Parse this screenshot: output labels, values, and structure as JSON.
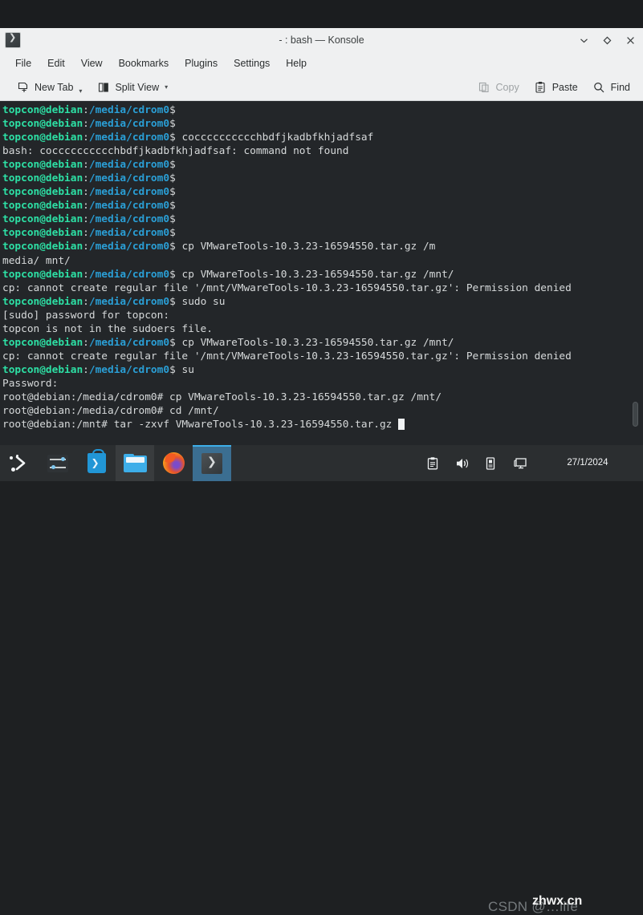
{
  "window": {
    "title": "- : bash — Konsole",
    "icon": "konsole-icon",
    "buttons": [
      {
        "name": "minimize-button",
        "glyph": "chevron-down-icon"
      },
      {
        "name": "maximize-button",
        "glyph": "diamond-icon"
      },
      {
        "name": "close-button",
        "glyph": "close-icon"
      }
    ]
  },
  "menubar": {
    "items": [
      {
        "label": "File"
      },
      {
        "label": "Edit"
      },
      {
        "label": "View"
      },
      {
        "label": "Bookmarks"
      },
      {
        "label": "Plugins"
      },
      {
        "label": "Settings"
      },
      {
        "label": "Help"
      }
    ]
  },
  "toolbar": {
    "new_tab_label": "New Tab",
    "split_view_label": "Split View",
    "copy_label": "Copy",
    "copy_enabled": false,
    "paste_label": "Paste",
    "find_label": "Find"
  },
  "terminal": {
    "prompt_user": "topcon@debian",
    "prompt_path": "/media/cdrom0",
    "prompt_sign": "$",
    "root_prompt_cdrom": "root@debian:/media/cdrom0#",
    "root_prompt_mnt": "root@debian:/mnt#",
    "colors": {
      "background": "#232629",
      "foreground": "#d6d9da",
      "user": "#2de0a5",
      "path": "#2a9fd6"
    },
    "lines": [
      {
        "type": "prompt",
        "cmd": ""
      },
      {
        "type": "prompt",
        "cmd": ""
      },
      {
        "type": "prompt",
        "cmd": " cocccccccccchbdfjkadbfkhjadfsaf"
      },
      {
        "type": "output",
        "text": "bash: cocccccccccchbdfjkadbfkhjadfsaf: command not found"
      },
      {
        "type": "prompt",
        "cmd": ""
      },
      {
        "type": "prompt",
        "cmd": ""
      },
      {
        "type": "prompt",
        "cmd": ""
      },
      {
        "type": "prompt",
        "cmd": ""
      },
      {
        "type": "prompt",
        "cmd": ""
      },
      {
        "type": "prompt",
        "cmd": ""
      },
      {
        "type": "prompt",
        "cmd": " cp VMwareTools-10.3.23-16594550.tar.gz /m"
      },
      {
        "type": "output",
        "text": "media/ mnt/"
      },
      {
        "type": "prompt",
        "cmd": " cp VMwareTools-10.3.23-16594550.tar.gz /mnt/"
      },
      {
        "type": "output",
        "text": "cp: cannot create regular file '/mnt/VMwareTools-10.3.23-16594550.tar.gz': Permission denied"
      },
      {
        "type": "prompt",
        "cmd": " sudo su"
      },
      {
        "type": "output",
        "text": "[sudo] password for topcon:"
      },
      {
        "type": "output",
        "text": "topcon is not in the sudoers file."
      },
      {
        "type": "prompt",
        "cmd": " cp VMwareTools-10.3.23-16594550.tar.gz /mnt/"
      },
      {
        "type": "output",
        "text": "cp: cannot create regular file '/mnt/VMwareTools-10.3.23-16594550.tar.gz': Permission denied"
      },
      {
        "type": "prompt",
        "cmd": " su"
      },
      {
        "type": "output",
        "text": "Password:"
      },
      {
        "type": "root",
        "prompt": "root@debian:/media/cdrom0#",
        "cmd": " cp VMwareTools-10.3.23-16594550.tar.gz /mnt/"
      },
      {
        "type": "root",
        "prompt": "root@debian:/media/cdrom0#",
        "cmd": " cd /mnt/"
      },
      {
        "type": "root-cursor",
        "prompt": "root@debian:/mnt#",
        "cmd": " tar -zxvf VMwareTools-10.3.23-16594550.tar.gz "
      }
    ]
  },
  "taskbar": {
    "launchers": [
      {
        "name": "kde-launcher-icon",
        "state": "normal"
      },
      {
        "name": "system-settings-icon",
        "state": "normal"
      },
      {
        "name": "software-store-icon",
        "state": "normal"
      },
      {
        "name": "file-manager-icon",
        "state": "hover"
      },
      {
        "name": "firefox-icon",
        "state": "normal"
      },
      {
        "name": "konsole-taskbar-icon",
        "state": "active"
      }
    ],
    "systray": [
      {
        "name": "clipboard-icon"
      },
      {
        "name": "volume-icon"
      },
      {
        "name": "usb-device-icon"
      },
      {
        "name": "display-icon"
      }
    ],
    "clock": {
      "date": "27/1/2024"
    }
  },
  "watermarks": {
    "csdn": "CSDN @…life",
    "site": "zhwx.cn"
  }
}
